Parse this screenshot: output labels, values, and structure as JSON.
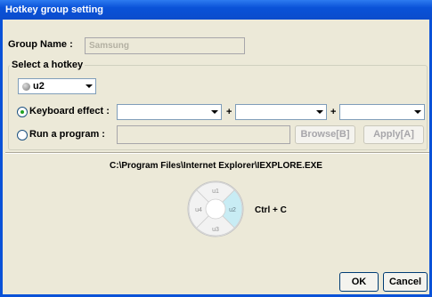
{
  "window": {
    "title": "Hotkey group setting"
  },
  "group_name": {
    "label": "Group Name :",
    "value": "Samsung"
  },
  "hotkey_group": {
    "title": "Select a hotkey",
    "selected_hotkey": "u2",
    "options": [
      {
        "label": "Keyboard effect :",
        "checked": true
      },
      {
        "label": "Run a program :",
        "checked": false
      }
    ],
    "plus_sign": "+",
    "browse_label": "Browse[B]",
    "apply_label": "Apply[A]"
  },
  "preview": {
    "program_path": "C:\\Program Files\\Internet Explorer\\IEXPLORE.EXE",
    "wheel": {
      "top": "u1",
      "right": "u2",
      "bottom": "u3",
      "left": "u4",
      "highlighted": "u2",
      "highlight_color": "#c8ecf4"
    },
    "shortcut": "Ctrl + C"
  },
  "footer": {
    "ok_label": "OK",
    "cancel_label": "Cancel"
  }
}
